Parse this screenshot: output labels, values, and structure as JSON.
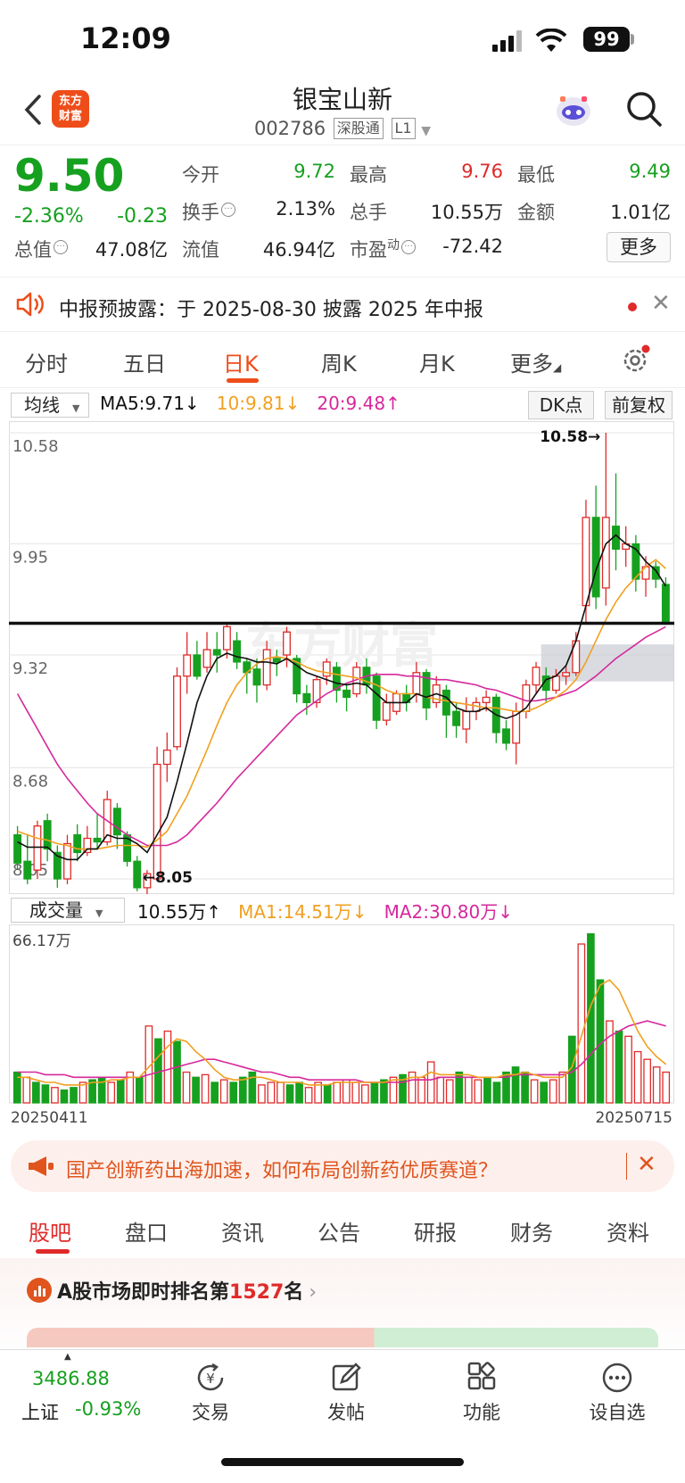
{
  "status": {
    "time": "12:09",
    "battery": "99"
  },
  "header": {
    "logo_line1": "东方",
    "logo_line2": "财富",
    "stock_name": "银宝山新",
    "stock_code": "002786",
    "tag1": "深股通",
    "tag2": "L1"
  },
  "quote": {
    "price": "9.50",
    "pct": "-2.36%",
    "chg": "-0.23",
    "open_label": "今开",
    "open": "9.72",
    "high_label": "最高",
    "high": "9.76",
    "low_label": "最低",
    "low": "9.49",
    "turnover_label": "换手",
    "turnover": "2.13%",
    "volume_label": "总手",
    "volume": "10.55万",
    "amount_label": "金额",
    "amount": "1.01亿",
    "mktcap_label": "总值",
    "mktcap": "47.08亿",
    "float_label": "流值",
    "float": "46.94亿",
    "pe_label": "市盈",
    "pe_sup": "动",
    "pe": "-72.42",
    "more": "更多"
  },
  "notice": {
    "text": "中报预披露：于 2025-08-30 披露 2025 年中报"
  },
  "chart_tabs": [
    "分时",
    "五日",
    "日K",
    "周K",
    "月K",
    "更多"
  ],
  "ma_bar": {
    "select": "均线",
    "ma5": "MA5:9.71↓",
    "ma10": "10:9.81↓",
    "ma20": "20:9.48↑",
    "dk": "DK点",
    "adjust": "前复权"
  },
  "vol_bar": {
    "select": "成交量",
    "vol": "10.55万↑",
    "ma1": "MA1:14.51万↓",
    "ma2": "MA2:30.80万↓"
  },
  "colors": {
    "up": "#e02a2a",
    "down": "#16a01f",
    "ma5": "#111111",
    "ma10": "#f0a020",
    "ma20": "#d6289c",
    "brand": "#ee4d1a"
  },
  "chart_data": {
    "type": "candlestick",
    "y_ticks": [
      "10.58",
      "9.95",
      "9.32",
      "8.68",
      "8.05"
    ],
    "ylim": [
      8.05,
      10.58
    ],
    "max_label": "10.58→",
    "min_label": "←8.05",
    "candles": [
      [
        8.3,
        8.14,
        8.35,
        8.1
      ],
      [
        8.15,
        8.05,
        8.3,
        8.02
      ],
      [
        8.1,
        8.35,
        8.38,
        8.05
      ],
      [
        8.38,
        8.22,
        8.42,
        8.15
      ],
      [
        8.2,
        8.05,
        8.24,
        8.0
      ],
      [
        8.05,
        8.25,
        8.3,
        8.02
      ],
      [
        8.3,
        8.2,
        8.36,
        8.15
      ],
      [
        8.2,
        8.28,
        8.35,
        8.18
      ],
      [
        8.28,
        8.26,
        8.42,
        8.22
      ],
      [
        8.26,
        8.5,
        8.55,
        8.24
      ],
      [
        8.45,
        8.3,
        8.48,
        8.22
      ],
      [
        8.3,
        8.15,
        8.32,
        8.12
      ],
      [
        8.15,
        8.0,
        8.18,
        7.98
      ],
      [
        8.0,
        8.08,
        8.1,
        7.92
      ],
      [
        8.05,
        8.7,
        8.8,
        8.04
      ],
      [
        8.7,
        8.78,
        8.88,
        8.6
      ],
      [
        8.8,
        9.2,
        9.25,
        8.78
      ],
      [
        9.2,
        9.32,
        9.45,
        9.1
      ],
      [
        9.32,
        9.2,
        9.4,
        9.18
      ],
      [
        9.25,
        9.35,
        9.45,
        9.22
      ],
      [
        9.35,
        9.32,
        9.45,
        9.22
      ],
      [
        9.35,
        9.48,
        9.5,
        9.3
      ],
      [
        9.4,
        9.28,
        9.45,
        9.24
      ],
      [
        9.28,
        9.22,
        9.3,
        9.1
      ],
      [
        9.24,
        9.15,
        9.3,
        9.05
      ],
      [
        9.15,
        9.35,
        9.4,
        9.12
      ],
      [
        9.3,
        9.28,
        9.35,
        9.2
      ],
      [
        9.32,
        9.45,
        9.48,
        9.25
      ],
      [
        9.3,
        9.1,
        9.32,
        9.05
      ],
      [
        9.1,
        9.05,
        9.15,
        8.98
      ],
      [
        9.05,
        9.18,
        9.2,
        9.02
      ],
      [
        9.2,
        9.28,
        9.3,
        9.15
      ],
      [
        9.25,
        9.12,
        9.28,
        9.05
      ],
      [
        9.12,
        9.08,
        9.16,
        9.0
      ],
      [
        9.1,
        9.25,
        9.28,
        9.08
      ],
      [
        9.25,
        9.15,
        9.3,
        9.1
      ],
      [
        9.2,
        8.95,
        9.22,
        8.9
      ],
      [
        8.95,
        9.05,
        9.1,
        8.92
      ],
      [
        9.0,
        9.1,
        9.12,
        8.98
      ],
      [
        9.1,
        9.05,
        9.15,
        9.0
      ],
      [
        9.1,
        9.22,
        9.28,
        9.05
      ],
      [
        9.22,
        9.02,
        9.24,
        8.95
      ],
      [
        9.05,
        9.15,
        9.2,
        9.02
      ],
      [
        9.12,
        8.98,
        9.15,
        8.85
      ],
      [
        9.0,
        8.92,
        9.05,
        8.85
      ],
      [
        8.9,
        9.0,
        9.08,
        8.82
      ],
      [
        9.0,
        9.05,
        9.08,
        8.95
      ],
      [
        9.05,
        9.08,
        9.12,
        9.0
      ],
      [
        9.08,
        8.88,
        9.1,
        8.82
      ],
      [
        8.9,
        8.82,
        8.95,
        8.78
      ],
      [
        8.82,
        9.0,
        9.05,
        8.7
      ],
      [
        9.0,
        9.15,
        9.18,
        8.96
      ],
      [
        9.15,
        9.25,
        9.28,
        9.1
      ],
      [
        9.2,
        9.12,
        9.25,
        9.05
      ],
      [
        9.12,
        9.2,
        9.24,
        9.1
      ],
      [
        9.2,
        9.22,
        9.26,
        9.15
      ],
      [
        9.22,
        9.4,
        9.45,
        9.2
      ],
      [
        9.6,
        10.1,
        10.2,
        9.5
      ],
      [
        10.1,
        9.65,
        10.28,
        9.58
      ],
      [
        9.7,
        10.1,
        10.58,
        9.6
      ],
      [
        10.05,
        9.92,
        10.35,
        9.8
      ],
      [
        9.92,
        9.95,
        10.05,
        9.82
      ],
      [
        9.95,
        9.75,
        10.0,
        9.68
      ],
      [
        9.75,
        9.82,
        9.88,
        9.65
      ],
      [
        9.82,
        9.75,
        9.85,
        9.7
      ],
      [
        9.72,
        9.5,
        9.76,
        9.49
      ]
    ],
    "ma5": [
      8.26,
      8.23,
      8.23,
      8.23,
      8.18,
      8.16,
      8.16,
      8.22,
      8.22,
      8.3,
      8.28,
      8.28,
      8.25,
      8.2,
      8.3,
      8.4,
      8.6,
      8.82,
      9.05,
      9.2,
      9.3,
      9.33,
      9.31,
      9.3,
      9.28,
      9.28,
      9.27,
      9.3,
      9.26,
      9.22,
      9.2,
      9.18,
      9.16,
      9.15,
      9.16,
      9.15,
      9.1,
      9.05,
      9.05,
      9.05,
      9.1,
      9.08,
      9.1,
      9.08,
      9.02,
      9.0,
      9.0,
      9.02,
      8.98,
      8.96,
      8.98,
      9.02,
      9.1,
      9.18,
      9.2,
      9.26,
      9.4,
      9.6,
      9.8,
      9.95,
      10.0,
      9.95,
      9.92,
      9.85,
      9.8,
      9.71
    ],
    "ma10": [
      8.32,
      8.3,
      8.28,
      8.27,
      8.25,
      8.24,
      8.22,
      8.22,
      8.22,
      8.23,
      8.24,
      8.24,
      8.24,
      8.23,
      8.27,
      8.32,
      8.42,
      8.52,
      8.65,
      8.78,
      8.92,
      9.05,
      9.15,
      9.22,
      9.27,
      9.3,
      9.31,
      9.3,
      9.28,
      9.25,
      9.23,
      9.22,
      9.21,
      9.2,
      9.19,
      9.17,
      9.15,
      9.12,
      9.1,
      9.1,
      9.1,
      9.08,
      9.07,
      9.06,
      9.05,
      9.04,
      9.03,
      9.02,
      9.02,
      9.01,
      9.0,
      9.0,
      9.02,
      9.05,
      9.08,
      9.12,
      9.18,
      9.28,
      9.4,
      9.52,
      9.62,
      9.7,
      9.76,
      9.82,
      9.86,
      9.81
    ],
    "ma20": [
      9.1,
      9.0,
      8.9,
      8.8,
      8.7,
      8.62,
      8.55,
      8.48,
      8.42,
      8.38,
      8.34,
      8.3,
      8.27,
      8.24,
      8.24,
      8.24,
      8.26,
      8.3,
      8.36,
      8.42,
      8.48,
      8.55,
      8.62,
      8.68,
      8.74,
      8.8,
      8.86,
      8.92,
      8.98,
      9.02,
      9.06,
      9.1,
      9.13,
      9.16,
      9.18,
      9.2,
      9.21,
      9.21,
      9.21,
      9.2,
      9.2,
      9.19,
      9.18,
      9.18,
      9.17,
      9.16,
      9.15,
      9.13,
      9.12,
      9.1,
      9.08,
      9.06,
      9.06,
      9.07,
      9.08,
      9.1,
      9.12,
      9.16,
      9.2,
      9.25,
      9.3,
      9.34,
      9.38,
      9.42,
      9.45,
      9.48
    ],
    "vol_max_label": "66.17万",
    "vol_max": 66.17,
    "volumes": [
      [
        12,
        0
      ],
      [
        10,
        1
      ],
      [
        8,
        0
      ],
      [
        7,
        0
      ],
      [
        6,
        1
      ],
      [
        5,
        0
      ],
      [
        6,
        0
      ],
      [
        8,
        1
      ],
      [
        9,
        0
      ],
      [
        10,
        0
      ],
      [
        8,
        1
      ],
      [
        9,
        0
      ],
      [
        12,
        1
      ],
      [
        10,
        0
      ],
      [
        30,
        1
      ],
      [
        25,
        0
      ],
      [
        28,
        1
      ],
      [
        24,
        0
      ],
      [
        12,
        1
      ],
      [
        10,
        0
      ],
      [
        11,
        1
      ],
      [
        8,
        0
      ],
      [
        9,
        1
      ],
      [
        8,
        0
      ],
      [
        10,
        0
      ],
      [
        12,
        0
      ],
      [
        7,
        1
      ],
      [
        8,
        1
      ],
      [
        8,
        1
      ],
      [
        7,
        0
      ],
      [
        8,
        0
      ],
      [
        6,
        1
      ],
      [
        8,
        1
      ],
      [
        7,
        0
      ],
      [
        8,
        1
      ],
      [
        9,
        1
      ],
      [
        8,
        1
      ],
      [
        7,
        1
      ],
      [
        8,
        0
      ],
      [
        9,
        0
      ],
      [
        10,
        1
      ],
      [
        11,
        0
      ],
      [
        12,
        1
      ],
      [
        10,
        1
      ],
      [
        16,
        1
      ],
      [
        10,
        1
      ],
      [
        9,
        1
      ],
      [
        12,
        0
      ],
      [
        10,
        1
      ],
      [
        9,
        1
      ],
      [
        10,
        0
      ],
      [
        8,
        0
      ],
      [
        12,
        0
      ],
      [
        14,
        0
      ],
      [
        12,
        0
      ],
      [
        9,
        1
      ],
      [
        8,
        0
      ],
      [
        9,
        1
      ],
      [
        12,
        1
      ],
      [
        26,
        0
      ],
      [
        62,
        1
      ],
      [
        66,
        0
      ],
      [
        48,
        0
      ],
      [
        32,
        1
      ],
      [
        28,
        0
      ],
      [
        26,
        1
      ],
      [
        20,
        1
      ],
      [
        17,
        1
      ],
      [
        14,
        1
      ],
      [
        12,
        1
      ]
    ],
    "vol_ma1": [
      10,
      10,
      9,
      8,
      8,
      7,
      7,
      7,
      8,
      8,
      9,
      9,
      10,
      10,
      14,
      18,
      22,
      25,
      24,
      20,
      17,
      13,
      10,
      9,
      9,
      10,
      10,
      9,
      8,
      8,
      8,
      7,
      7,
      7,
      8,
      8,
      8,
      8,
      8,
      8,
      9,
      9,
      10,
      10,
      12,
      11,
      11,
      11,
      11,
      10,
      10,
      10,
      11,
      11,
      12,
      11,
      10,
      10,
      10,
      14,
      26,
      38,
      46,
      48,
      44,
      36,
      28,
      22,
      18,
      15
    ],
    "vol_ma2": [
      12,
      12,
      12,
      11,
      11,
      11,
      10,
      10,
      10,
      10,
      10,
      10,
      10,
      10,
      11,
      12,
      13,
      14,
      15,
      16,
      17,
      17,
      16,
      15,
      14,
      13,
      12,
      12,
      11,
      10,
      10,
      9,
      9,
      9,
      9,
      9,
      9,
      8,
      8,
      8,
      8,
      8,
      9,
      9,
      9,
      10,
      10,
      10,
      10,
      10,
      10,
      10,
      10,
      11,
      11,
      11,
      11,
      11,
      11,
      12,
      15,
      19,
      23,
      26,
      28,
      30,
      31,
      32,
      31,
      30
    ],
    "x_start_label": "20250411",
    "x_end_label": "20250715"
  },
  "ad": {
    "text": "国产创新药出海加速，如何布局创新药优质赛道？"
  },
  "bottom_tabs": [
    "股吧",
    "盘口",
    "资讯",
    "公告",
    "研报",
    "财务",
    "资料"
  ],
  "rank": {
    "prefix": "A股市场即时排名第",
    "num": "1527",
    "suffix": "名"
  },
  "index": {
    "value": "3486.88",
    "name": "上证",
    "pct": "-0.93%"
  },
  "nav": [
    "交易",
    "发帖",
    "功能",
    "设自选"
  ]
}
